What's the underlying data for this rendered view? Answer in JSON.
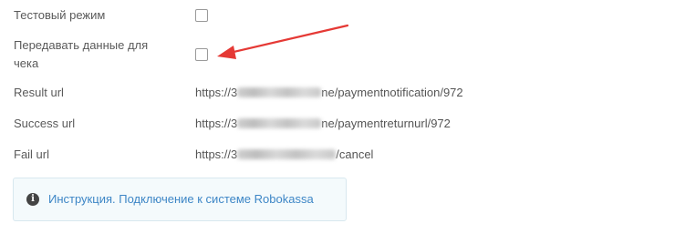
{
  "settings": {
    "test_mode_label": "Тестовый режим",
    "send_receipt_label_line1": "Передавать данные для",
    "send_receipt_label_line2": "чека",
    "test_mode_checked": false,
    "send_receipt_checked": false
  },
  "urls": {
    "result_label": "Result url",
    "result_prefix": "https://3",
    "result_suffix": "ne/paymentnotification/972",
    "success_label": "Success url",
    "success_prefix": "https://3",
    "success_suffix": "ne/paymentreturnurl/972",
    "fail_label": "Fail url",
    "fail_prefix": "https://3",
    "fail_suffix": "/cancel"
  },
  "info": {
    "link_text": "Инструкция. Подключение к системе Robokassa",
    "icon": "info-icon"
  },
  "annotation": {
    "arrow_color": "#e53935"
  }
}
